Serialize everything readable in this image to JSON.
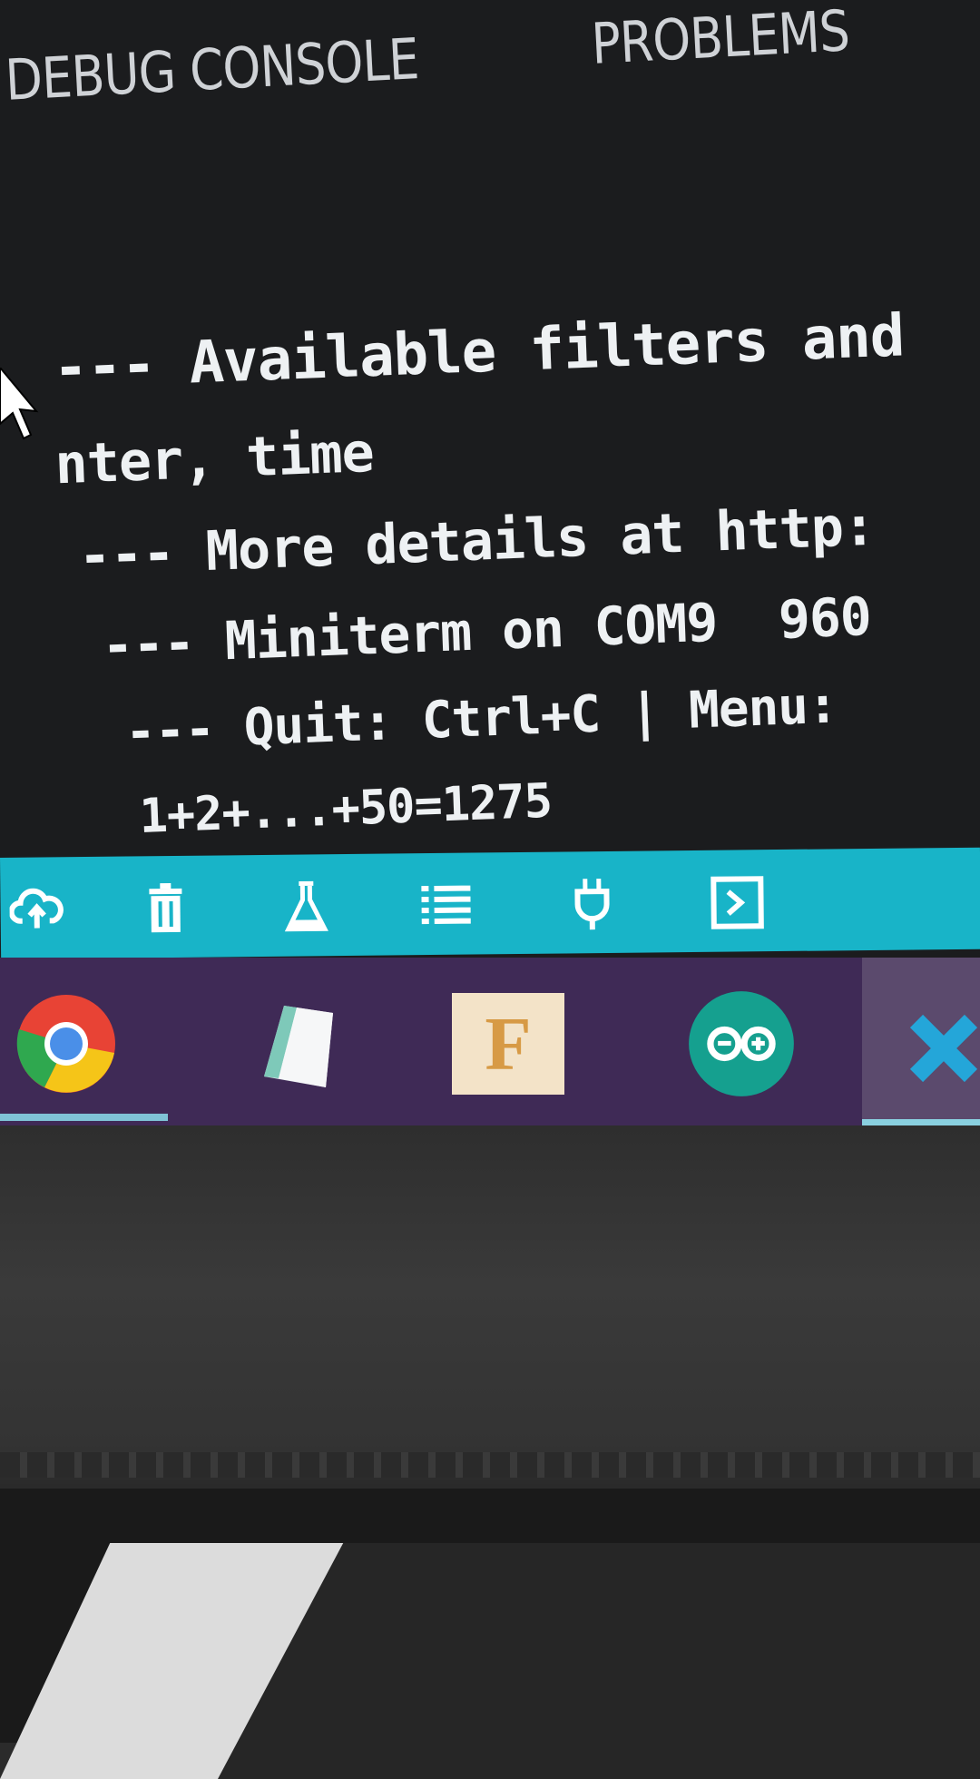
{
  "panel": {
    "tabs": [
      {
        "label": "DEBUG CONSOLE"
      },
      {
        "label": "PROBLEMS"
      }
    ]
  },
  "terminal": {
    "lines": [
      "--- Available filters and",
      "nter, time",
      "--- More details at http:",
      "--- Miniterm on COM9  960",
      "--- Quit: Ctrl+C | Menu:",
      "1+2+...+50=1275"
    ]
  },
  "statusbar": {
    "icons": [
      "upload-icon",
      "trash-icon",
      "flask-icon",
      "list-icon",
      "plug-icon",
      "terminal-icon"
    ],
    "color": "#18b4c8"
  },
  "taskbar": {
    "apps": [
      "chrome-icon",
      "notepad-icon",
      "f-app-icon",
      "arduino-icon",
      "vscode-icon"
    ],
    "f_app_letter": "F",
    "color": "#3f2a56"
  }
}
